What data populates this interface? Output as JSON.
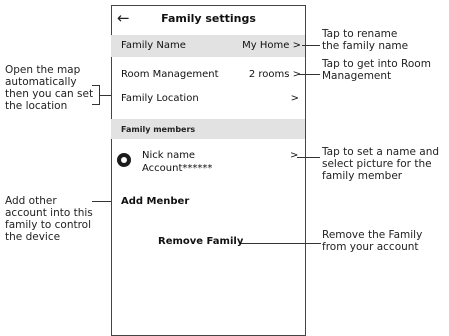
{
  "header": {
    "back_glyph": "←",
    "title": "Family settings"
  },
  "rows": {
    "family_name": {
      "label": "Family Name",
      "value": "My Home >"
    },
    "room_management": {
      "label": "Room Management",
      "value": "2 rooms >"
    },
    "family_location": {
      "label": "Family Location",
      "value": ">"
    }
  },
  "members": {
    "section_label": "Family members",
    "nickname": "Nick name",
    "account": "Account******",
    "arrow": ">"
  },
  "actions": {
    "add_member": "Add Menber",
    "remove_family": "Remove Family"
  },
  "annotations": {
    "rename": [
      "Tap to rename",
      "the family name"
    ],
    "room": [
      "Tap to get into Room",
      "Management"
    ],
    "map": [
      "Open the map",
      "automatically",
      "then you can set",
      "the location"
    ],
    "member": [
      "Tap to set a name and",
      "select picture for the",
      "family member"
    ],
    "add": [
      "Add other",
      "account into this",
      "family to control",
      "the device"
    ],
    "remove": [
      "Remove the Family",
      "from your account"
    ]
  }
}
